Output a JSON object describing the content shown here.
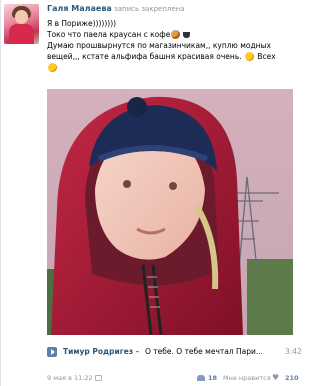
{
  "post": {
    "author": "Галя Малаева",
    "pinned_label": "запись закреплена",
    "text_lines": [
      "Я в Пориже))))))))",
      "Токо что паела краусан с кофе",
      "Думаю прошвырнутся по магазинчикам,, куплю модных",
      "вещей,,, кстате альфифа башня красивая очень.",
      "Всех"
    ],
    "emoji": [
      "bread-icon",
      "coffee-cup-icon",
      "smile-icon",
      "kiss-icon"
    ]
  },
  "audio": {
    "artist": "Тимур Родригез",
    "separator": " – ",
    "title": "О тебе. О тебе мечтал Пари...",
    "duration": "3:42"
  },
  "footer": {
    "date": "9 мая в 11:22",
    "share_count": "18",
    "like_label": "Мне нравится",
    "like_count": "210"
  }
}
